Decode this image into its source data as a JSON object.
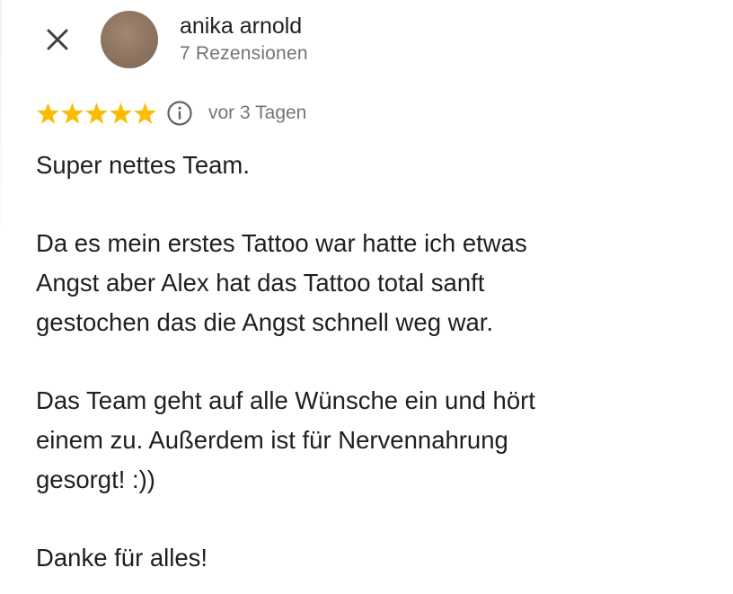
{
  "close": {
    "icon": "close-icon"
  },
  "reviewer": {
    "name": "anika arnold",
    "review_count": "7 Rezensionen",
    "avatar_color": "#8a725f"
  },
  "rating": {
    "stars": 5,
    "max_stars": 5,
    "star_color": "#fbbc04",
    "info_icon": "info-circle-icon",
    "date": "vor 3 Tagen"
  },
  "review": {
    "paragraphs": [
      [
        "Super nettes Team."
      ],
      [
        "Da es mein erstes Tattoo war hatte ich etwas",
        "Angst aber Alex hat das Tattoo total sanft",
        "gestochen das die Angst schnell weg war."
      ],
      [
        "Das Team geht auf alle Wünsche ein und hört",
        "einem zu. Außerdem ist für Nervennahrung",
        "gesorgt! :))"
      ],
      [
        "Danke für alles!"
      ]
    ]
  }
}
